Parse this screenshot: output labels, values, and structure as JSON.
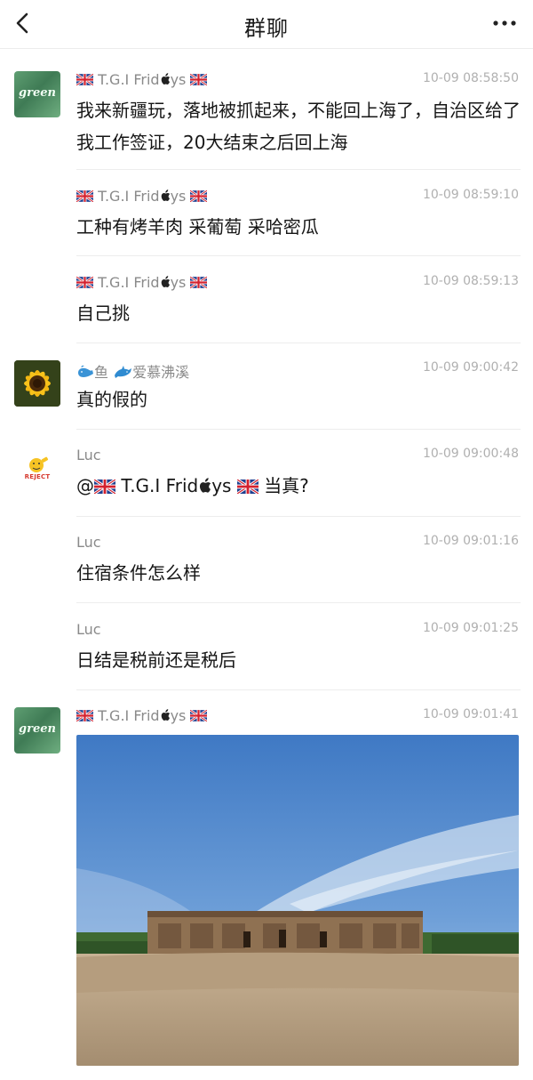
{
  "header": {
    "title": "群聊"
  },
  "messages": [
    {
      "name_prefix": "T.G.I Frid",
      "name_suffix": "ys",
      "time": "10-09 08:58:50",
      "text": "我来新疆玩，落地被抓起来，不能回上海了，自治区给了我工作签证，20大结束之后回上海"
    },
    {
      "name_prefix": "T.G.I Frid",
      "name_suffix": "ys",
      "time": "10-09 08:59:10",
      "text": "工种有烤羊肉 采葡萄 采哈密瓜"
    },
    {
      "name_prefix": "T.G.I Frid",
      "name_suffix": "ys",
      "time": "10-09 08:59:13",
      "text": "自己挑"
    },
    {
      "name_a": "鱼",
      "name_b": "爱慕沸溪",
      "time": "10-09 09:00:42",
      "text": "真的假的"
    },
    {
      "name": "Luc",
      "time": "10-09 09:00:48",
      "at": "@",
      "mention_prefix": "T.G.I Frid",
      "mention_suffix": "ys",
      "text_tail": " 当真?"
    },
    {
      "name": "Luc",
      "time": "10-09 09:01:16",
      "text": "住宿条件怎么样"
    },
    {
      "name": "Luc",
      "time": "10-09 09:01:25",
      "text": "日结是税前还是税后"
    },
    {
      "name_prefix": "T.G.I Frid",
      "name_suffix": "ys",
      "time": "10-09 09:01:41"
    }
  ],
  "avatars": {
    "green_label": "green",
    "reject_label": "REJECT"
  },
  "icons": [
    "back-chevron-icon",
    "more-dots-icon",
    "uk-flag-icon",
    "apple-logo-icon",
    "whale-icon",
    "dolphin-icon"
  ]
}
